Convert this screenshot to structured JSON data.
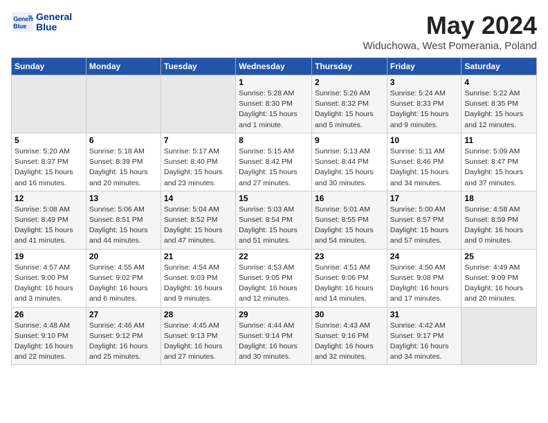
{
  "logo": {
    "line1": "General",
    "line2": "Blue"
  },
  "title": "May 2024",
  "subtitle": "Widuchowa, West Pomerania, Poland",
  "weekdays": [
    "Sunday",
    "Monday",
    "Tuesday",
    "Wednesday",
    "Thursday",
    "Friday",
    "Saturday"
  ],
  "weeks": [
    [
      {
        "day": "",
        "info": ""
      },
      {
        "day": "",
        "info": ""
      },
      {
        "day": "",
        "info": ""
      },
      {
        "day": "1",
        "info": "Sunrise: 5:28 AM\nSunset: 8:30 PM\nDaylight: 15 hours\nand 1 minute."
      },
      {
        "day": "2",
        "info": "Sunrise: 5:26 AM\nSunset: 8:32 PM\nDaylight: 15 hours\nand 5 minutes."
      },
      {
        "day": "3",
        "info": "Sunrise: 5:24 AM\nSunset: 8:33 PM\nDaylight: 15 hours\nand 9 minutes."
      },
      {
        "day": "4",
        "info": "Sunrise: 5:22 AM\nSunset: 8:35 PM\nDaylight: 15 hours\nand 12 minutes."
      }
    ],
    [
      {
        "day": "5",
        "info": "Sunrise: 5:20 AM\nSunset: 8:37 PM\nDaylight: 15 hours\nand 16 minutes."
      },
      {
        "day": "6",
        "info": "Sunrise: 5:18 AM\nSunset: 8:39 PM\nDaylight: 15 hours\nand 20 minutes."
      },
      {
        "day": "7",
        "info": "Sunrise: 5:17 AM\nSunset: 8:40 PM\nDaylight: 15 hours\nand 23 minutes."
      },
      {
        "day": "8",
        "info": "Sunrise: 5:15 AM\nSunset: 8:42 PM\nDaylight: 15 hours\nand 27 minutes."
      },
      {
        "day": "9",
        "info": "Sunrise: 5:13 AM\nSunset: 8:44 PM\nDaylight: 15 hours\nand 30 minutes."
      },
      {
        "day": "10",
        "info": "Sunrise: 5:11 AM\nSunset: 8:46 PM\nDaylight: 15 hours\nand 34 minutes."
      },
      {
        "day": "11",
        "info": "Sunrise: 5:09 AM\nSunset: 8:47 PM\nDaylight: 15 hours\nand 37 minutes."
      }
    ],
    [
      {
        "day": "12",
        "info": "Sunrise: 5:08 AM\nSunset: 8:49 PM\nDaylight: 15 hours\nand 41 minutes."
      },
      {
        "day": "13",
        "info": "Sunrise: 5:06 AM\nSunset: 8:51 PM\nDaylight: 15 hours\nand 44 minutes."
      },
      {
        "day": "14",
        "info": "Sunrise: 5:04 AM\nSunset: 8:52 PM\nDaylight: 15 hours\nand 47 minutes."
      },
      {
        "day": "15",
        "info": "Sunrise: 5:03 AM\nSunset: 8:54 PM\nDaylight: 15 hours\nand 51 minutes."
      },
      {
        "day": "16",
        "info": "Sunrise: 5:01 AM\nSunset: 8:55 PM\nDaylight: 15 hours\nand 54 minutes."
      },
      {
        "day": "17",
        "info": "Sunrise: 5:00 AM\nSunset: 8:57 PM\nDaylight: 15 hours\nand 57 minutes."
      },
      {
        "day": "18",
        "info": "Sunrise: 4:58 AM\nSunset: 8:59 PM\nDaylight: 16 hours\nand 0 minutes."
      }
    ],
    [
      {
        "day": "19",
        "info": "Sunrise: 4:57 AM\nSunset: 9:00 PM\nDaylight: 16 hours\nand 3 minutes."
      },
      {
        "day": "20",
        "info": "Sunrise: 4:55 AM\nSunset: 9:02 PM\nDaylight: 16 hours\nand 6 minutes."
      },
      {
        "day": "21",
        "info": "Sunrise: 4:54 AM\nSunset: 9:03 PM\nDaylight: 16 hours\nand 9 minutes."
      },
      {
        "day": "22",
        "info": "Sunrise: 4:53 AM\nSunset: 9:05 PM\nDaylight: 16 hours\nand 12 minutes."
      },
      {
        "day": "23",
        "info": "Sunrise: 4:51 AM\nSunset: 9:06 PM\nDaylight: 16 hours\nand 14 minutes."
      },
      {
        "day": "24",
        "info": "Sunrise: 4:50 AM\nSunset: 9:08 PM\nDaylight: 16 hours\nand 17 minutes."
      },
      {
        "day": "25",
        "info": "Sunrise: 4:49 AM\nSunset: 9:09 PM\nDaylight: 16 hours\nand 20 minutes."
      }
    ],
    [
      {
        "day": "26",
        "info": "Sunrise: 4:48 AM\nSunset: 9:10 PM\nDaylight: 16 hours\nand 22 minutes."
      },
      {
        "day": "27",
        "info": "Sunrise: 4:46 AM\nSunset: 9:12 PM\nDaylight: 16 hours\nand 25 minutes."
      },
      {
        "day": "28",
        "info": "Sunrise: 4:45 AM\nSunset: 9:13 PM\nDaylight: 16 hours\nand 27 minutes."
      },
      {
        "day": "29",
        "info": "Sunrise: 4:44 AM\nSunset: 9:14 PM\nDaylight: 16 hours\nand 30 minutes."
      },
      {
        "day": "30",
        "info": "Sunrise: 4:43 AM\nSunset: 9:16 PM\nDaylight: 16 hours\nand 32 minutes."
      },
      {
        "day": "31",
        "info": "Sunrise: 4:42 AM\nSunset: 9:17 PM\nDaylight: 16 hours\nand 34 minutes."
      },
      {
        "day": "",
        "info": ""
      }
    ]
  ]
}
